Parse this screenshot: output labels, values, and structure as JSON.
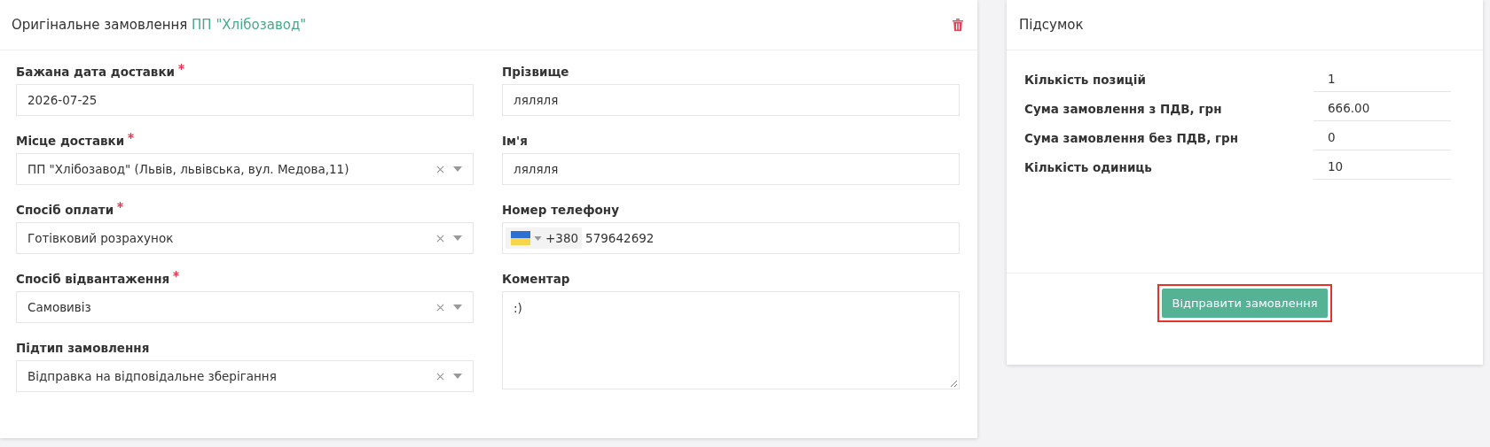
{
  "order_card": {
    "title": "Оригінальне замовлення",
    "supplier": "ПП \"Хлібозавод\"",
    "left_fields": [
      {
        "kind": "input",
        "label": "Бажана дата доставки",
        "required": true,
        "value": "2026-07-25"
      },
      {
        "kind": "select",
        "label": "Місце доставки",
        "required": true,
        "value": "ПП \"Хлібозавод\" (Львів, львівська, вул. Медова,11)"
      },
      {
        "kind": "select",
        "label": "Спосіб оплати",
        "required": true,
        "value": "Готівковий розрахунок"
      },
      {
        "kind": "select",
        "label": "Спосіб відвантаження",
        "required": true,
        "value": "Самовивіз"
      },
      {
        "kind": "select",
        "label": "Підтип замовлення",
        "required": false,
        "value": "Відправка на відповідальне зберігання"
      }
    ],
    "right_fields": [
      {
        "kind": "input",
        "label": "Прізвище",
        "value": "ляляля"
      },
      {
        "kind": "input",
        "label": "Ім'я",
        "value": "ляляля"
      },
      {
        "kind": "phone",
        "label": "Номер телефону",
        "code": "+380",
        "value": "579642692"
      },
      {
        "kind": "textarea",
        "label": "Коментар",
        "value": ":)"
      }
    ]
  },
  "summary_card": {
    "title": "Підсумок",
    "rows": [
      {
        "label": "Кількість позицій",
        "value": "1"
      },
      {
        "label": "Сума замовлення з ПДВ, грн",
        "value": "666.00"
      },
      {
        "label": "Сума замовлення без ПДВ, грн",
        "value": "0"
      },
      {
        "label": "Кількість одиниць",
        "value": "10"
      }
    ],
    "button": {
      "label": "Відправити замовлення",
      "highlighted": true
    }
  }
}
